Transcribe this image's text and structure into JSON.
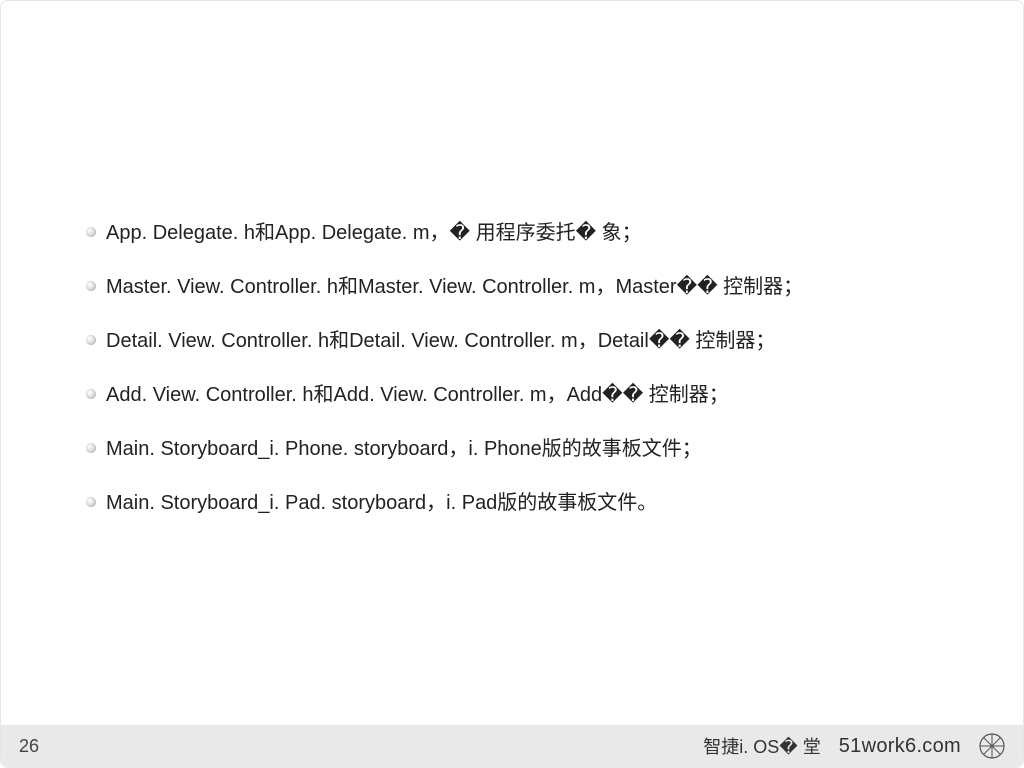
{
  "list": {
    "items": [
      "App. Delegate. h和App. Delegate. m，� 用程序委托� 象；",
      "Master. View. Controller. h和Master. View. Controller. m，Master�� 控制器；",
      "Detail. View. Controller. h和Detail. View. Controller. m，Detail�� 控制器；",
      "Add. View. Controller. h和Add. View. Controller. m，Add�� 控制器；",
      "Main. Storyboard_i. Phone. storyboard，i. Phone版的故事板文件；",
      "Main. Storyboard_i. Pad. storyboard，i. Pad版的故事板文件。"
    ]
  },
  "footer": {
    "page_number": "26",
    "right_text": "智捷i. OS� 堂",
    "brand": "51work6.com"
  }
}
